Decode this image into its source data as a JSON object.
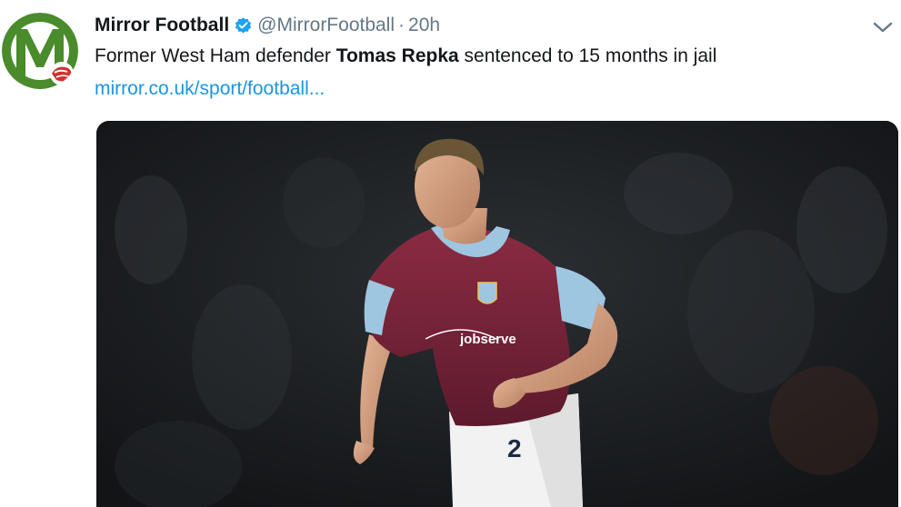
{
  "account": {
    "display_name": "Mirror Football",
    "handle": "@MirrorFootball",
    "separator": "·",
    "timestamp": "20h",
    "verified": true
  },
  "tweet": {
    "text_before": "Former West Ham defender ",
    "text_bold": "Tomas Repka",
    "text_after": " sentenced to 15 months in jail",
    "link": "mirror.co.uk/sport/football..."
  },
  "media": {
    "shirt_sponsor": "jobserve",
    "shirt_number": "2",
    "alt": "Tomas Repka in West Ham kit"
  },
  "icons": {
    "avatar": "mirror-m-logo-icon",
    "verified": "verified-badge-icon",
    "menu": "chevron-down-icon"
  },
  "colors": {
    "link": "#1b95e0",
    "secondary_text": "#657786",
    "verified": "#1da1f2",
    "avatar_green": "#4a8b2c",
    "claret": "#7a2438",
    "sky_blue": "#9ec6e0"
  }
}
